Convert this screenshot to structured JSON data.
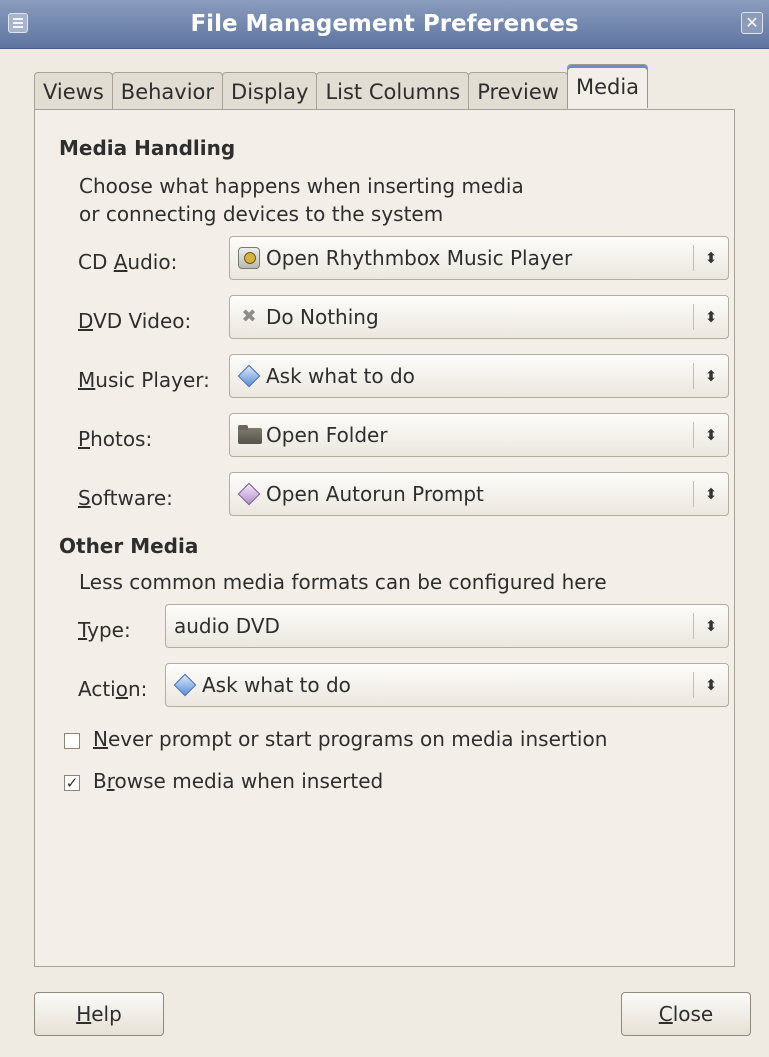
{
  "window": {
    "title": "File Management Preferences"
  },
  "tabs": [
    {
      "label": "Views"
    },
    {
      "label": "Behavior"
    },
    {
      "label": "Display"
    },
    {
      "label": "List Columns"
    },
    {
      "label": "Preview"
    },
    {
      "label": "Media",
      "active": true
    }
  ],
  "media_handling": {
    "title": "Media Handling",
    "description_line1": "Choose what happens when inserting media",
    "description_line2": "or connecting devices to the system",
    "rows": [
      {
        "label_pre": "CD ",
        "label_mnemonic": "A",
        "label_post": "udio:",
        "value": "Open Rhythmbox Music Player",
        "icon": "rhythmbox-icon"
      },
      {
        "label_pre": "",
        "label_mnemonic": "D",
        "label_post": "VD Video:",
        "value": "Do Nothing",
        "icon": "do-nothing-icon"
      },
      {
        "label_pre": "",
        "label_mnemonic": "M",
        "label_post": "usic Player:",
        "value": "Ask what to do",
        "icon": "ask-icon"
      },
      {
        "label_pre": "",
        "label_mnemonic": "P",
        "label_post": "hotos:",
        "value": "Open Folder",
        "icon": "folder-icon"
      },
      {
        "label_pre": "",
        "label_mnemonic": "S",
        "label_post": "oftware:",
        "value": "Open Autorun Prompt",
        "icon": "autorun-icon"
      }
    ]
  },
  "other_media": {
    "title": "Other Media",
    "description": "Less common media formats can be configured here",
    "type_label_mnemonic": "T",
    "type_label_rest": "ype:",
    "type_value": "audio DVD",
    "action_label_pre": "Acti",
    "action_label_mnemonic": "o",
    "action_label_post": "n:",
    "action_value": "Ask what to do"
  },
  "options": {
    "never_prompt": {
      "mnemonic": "N",
      "rest": "ever prompt or start programs on media insertion",
      "checked": false
    },
    "browse_media": {
      "pre": "B",
      "mnemonic": "r",
      "rest": "owse media when inserted",
      "checked": true
    }
  },
  "buttons": {
    "help_mnemonic": "H",
    "help_rest": "elp",
    "close_mnemonic": "C",
    "close_rest": "lose"
  },
  "icons": {
    "window_menu": "window-menu-icon",
    "window_close": "close-icon",
    "combo_arrow": "up-down-arrow-icon",
    "checkbox_checked": "✓"
  },
  "colors": {
    "titlebar_top": "#8a9cbd",
    "titlebar_bottom": "#5f75a0",
    "background": "#f0ebe2",
    "active_tab_accent": "#6a8ccf"
  }
}
